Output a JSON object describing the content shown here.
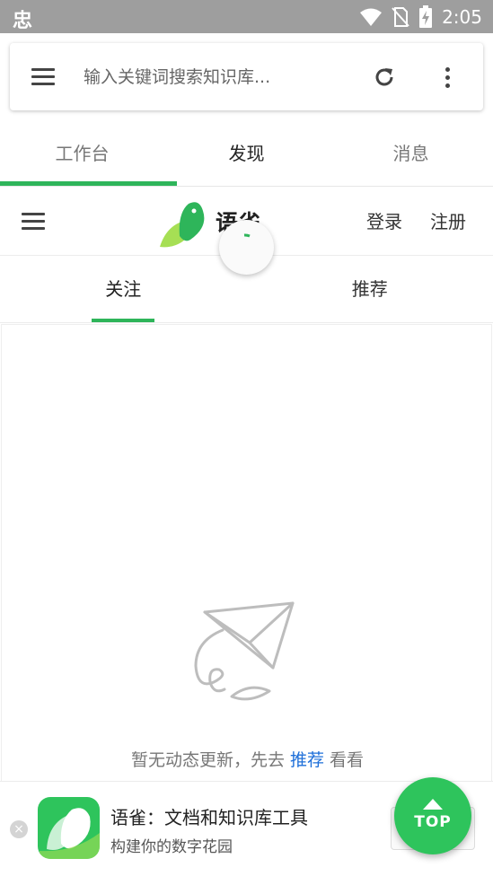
{
  "status_bar": {
    "left_glyph": "忠",
    "time": "2:05"
  },
  "search": {
    "placeholder": "输入关键词搜索知识库..."
  },
  "top_tabs": [
    {
      "label": "工作台"
    },
    {
      "label": "发现"
    },
    {
      "label": "消息"
    }
  ],
  "web_header": {
    "brand": "语雀",
    "login": "登录",
    "register": "注册"
  },
  "sub_tabs": [
    {
      "label": "关注"
    },
    {
      "label": "推荐"
    }
  ],
  "empty_state": {
    "prefix": "暂无动态更新，先去 ",
    "link": "推荐",
    "suffix": " 看看"
  },
  "app_banner": {
    "title": "语雀：文档和知识库工具",
    "subtitle": "构建你的数字花园",
    "close_glyph": "×"
  },
  "top_button": {
    "label": "TOP"
  },
  "colors": {
    "accent": "#2eb55a",
    "link": "#1e6fd9",
    "status_bar": "#9e9e9e"
  }
}
